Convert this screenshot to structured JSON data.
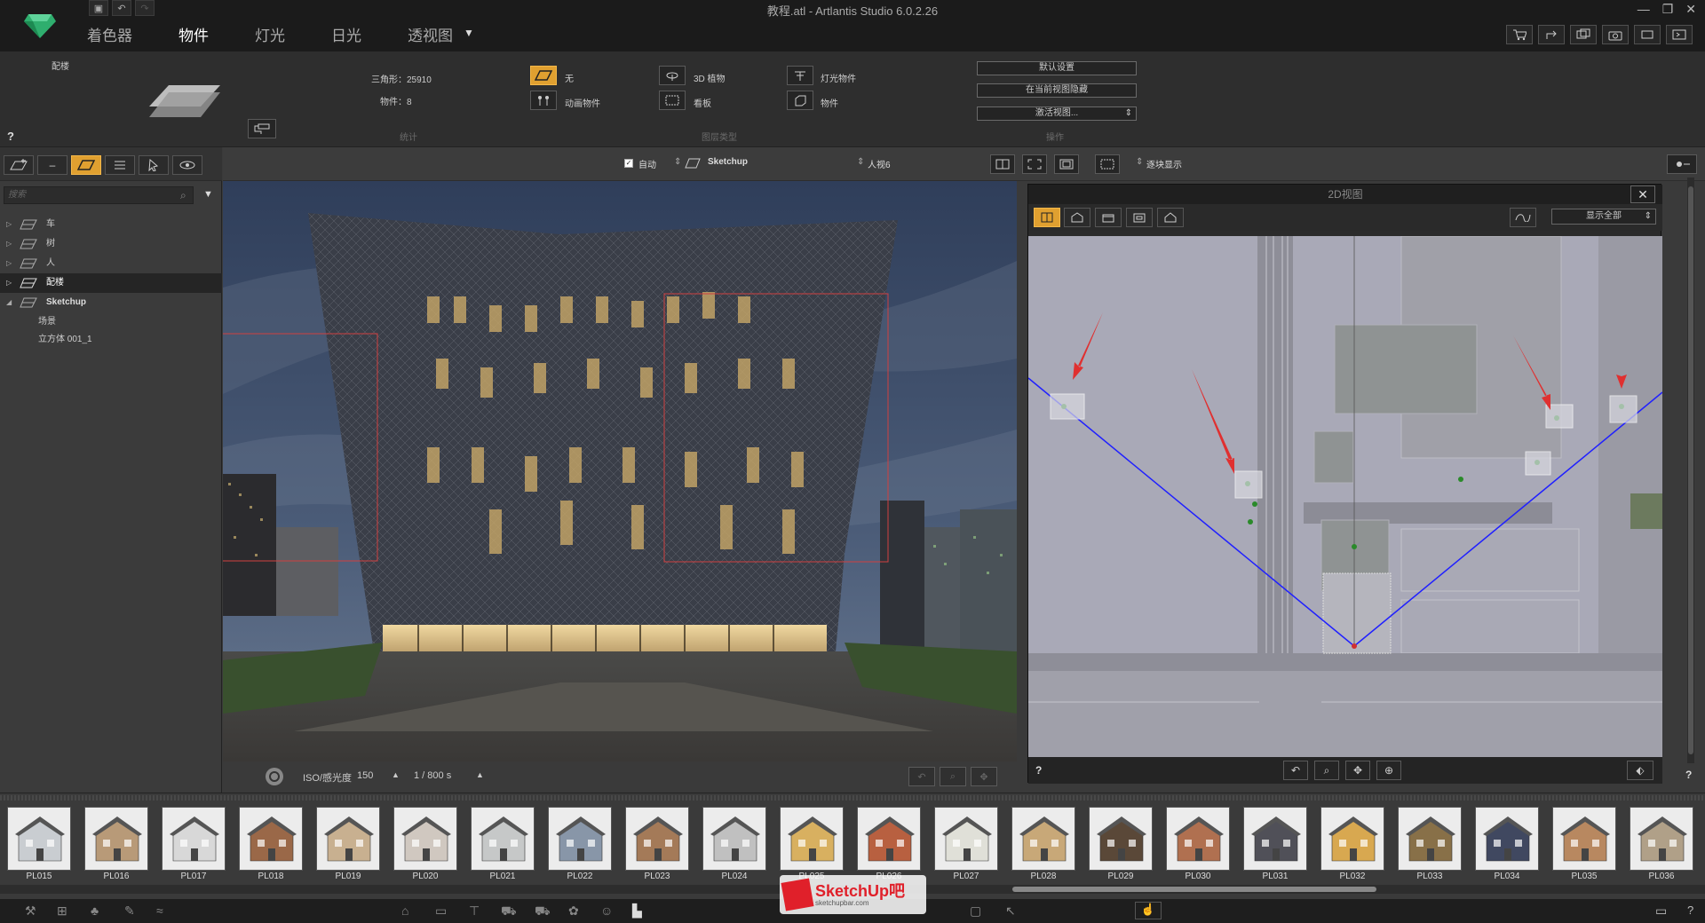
{
  "window": {
    "title": "教程.atl - Artlantis Studio 6.0.2.26"
  },
  "tabs": [
    {
      "label": "着色器"
    },
    {
      "label": "物件"
    },
    {
      "label": "灯光"
    },
    {
      "label": "日光"
    },
    {
      "label": "透视图"
    }
  ],
  "ribbon": {
    "layer_label": "配楼",
    "help": "?",
    "triangles": "三角形：25910",
    "objects": "物件：8",
    "stats_caption": "统计",
    "none_label": "无",
    "plant3d_label": "3D 植物",
    "light_object_label": "灯光物件",
    "anim_object_label": "动画物件",
    "billboard_label": "看板",
    "object_label": "物件",
    "layer_type_caption": "图层类型",
    "default_settings": "默认设置",
    "hide_in_view": "在当前视图隐藏",
    "activate_view": "激活视图...",
    "options_caption": "操作"
  },
  "left_panel": {
    "search_placeholder": "搜索",
    "tree": [
      {
        "label": "车",
        "selected": false,
        "expanded": false
      },
      {
        "label": "树",
        "selected": false,
        "expanded": false
      },
      {
        "label": "人",
        "selected": false,
        "expanded": false
      },
      {
        "label": "配楼",
        "selected": true,
        "expanded": false
      },
      {
        "label": "Sketchup",
        "selected": false,
        "expanded": true
      }
    ],
    "children": [
      "场景",
      "立方体 001_1"
    ]
  },
  "viewport": {
    "auto_label": "自动",
    "source": "Sketchup",
    "view_name": "人视6",
    "display_mode": "逐块显示",
    "iso_label": "ISO/感光度",
    "iso_value": "150",
    "shutter_label": "1 / 800 s"
  },
  "view2d": {
    "title": "2D视图",
    "show_all": "显示全部",
    "help": "?"
  },
  "library": {
    "items": [
      "PL015",
      "PL016",
      "PL017",
      "PL018",
      "PL019",
      "PL020",
      "PL021",
      "PL022",
      "PL023",
      "PL024",
      "PL025",
      "PL026",
      "PL027",
      "PL028",
      "PL029",
      "PL030",
      "PL031",
      "PL032",
      "PL033",
      "PL034",
      "PL035",
      "PL036"
    ],
    "colors": [
      "#c9cdd1",
      "#b89a78",
      "#d8d8d8",
      "#9a6848",
      "#c8b090",
      "#d0c8c0",
      "#c6c8c8",
      "#8896a8",
      "#a47a58",
      "#c0c0c0",
      "#d8b060",
      "#b86040",
      "#e0e0d8",
      "#c8a878",
      "#5a4838",
      "#b07050",
      "#505058",
      "#d8a850",
      "#887048",
      "#404860",
      "#b88860",
      "#b0a088"
    ]
  },
  "watermark": {
    "brand": "SketchUp吧",
    "url": "sketchupbar.com"
  },
  "bottom": {
    "help": "?"
  }
}
